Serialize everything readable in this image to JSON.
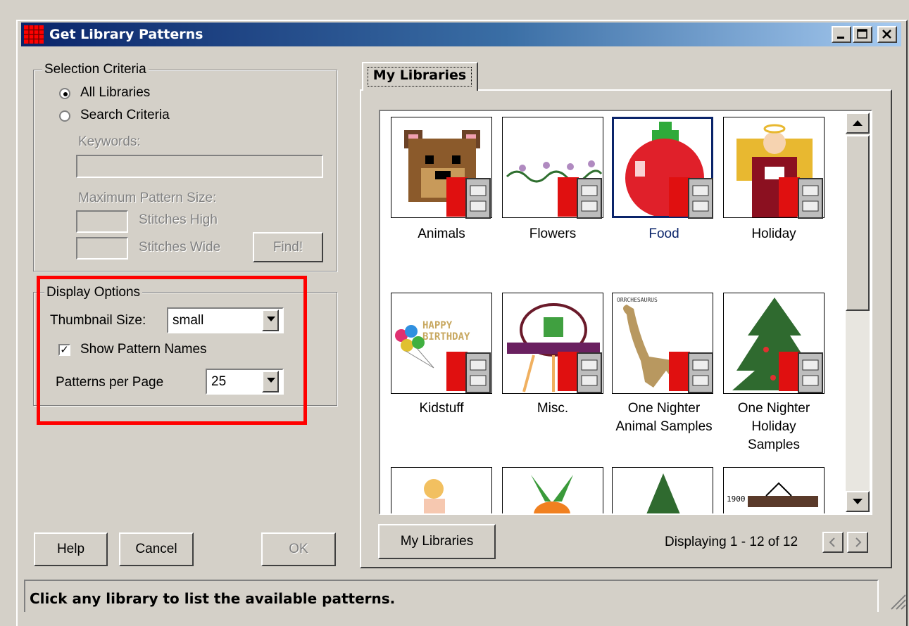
{
  "window": {
    "title": "Get Library Patterns"
  },
  "selection": {
    "legend": "Selection Criteria",
    "all_libraries": "All Libraries",
    "search_criteria": "Search Criteria",
    "keywords_label": "Keywords:",
    "keywords_value": "",
    "max_size_label": "Maximum Pattern Size:",
    "stitches_high": "Stitches High",
    "stitches_wide": "Stitches Wide",
    "find_button": "Find!"
  },
  "display": {
    "legend": "Display Options",
    "thumbnail_label": "Thumbnail Size:",
    "thumbnail_value": "small",
    "show_names_label": "Show Pattern Names",
    "show_names_checked": true,
    "per_page_label": "Patterns per Page",
    "per_page_value": "25"
  },
  "buttons": {
    "help": "Help",
    "cancel": "Cancel",
    "ok": "OK"
  },
  "tab": {
    "label": "My Libraries"
  },
  "libraries": [
    {
      "name": "Animals",
      "icon": "bear-icon"
    },
    {
      "name": "Flowers",
      "icon": "flowers-icon"
    },
    {
      "name": "Food",
      "icon": "apple-icon",
      "selected": true
    },
    {
      "name": "Holiday",
      "icon": "angel-icon"
    },
    {
      "name": "Kidstuff",
      "icon": "balloons-icon"
    },
    {
      "name": "Misc.",
      "icon": "ufo-icon"
    },
    {
      "name": "One Nighter Animal Samples",
      "icon": "dinosaur-icon"
    },
    {
      "name": "One Nighter Holiday Samples",
      "icon": "christmas-tree-icon"
    }
  ],
  "thumb_text": {
    "birthday_line1": "HAPPY",
    "birthday_line2": "BIRTHDAY",
    "dino_caption": "ORRCHESAURUS",
    "year": "1900"
  },
  "footer": {
    "my_libraries_button": "My Libraries",
    "displaying": "Displaying 1 - 12 of 12"
  },
  "status": {
    "message": "Click any library to list the available patterns."
  }
}
